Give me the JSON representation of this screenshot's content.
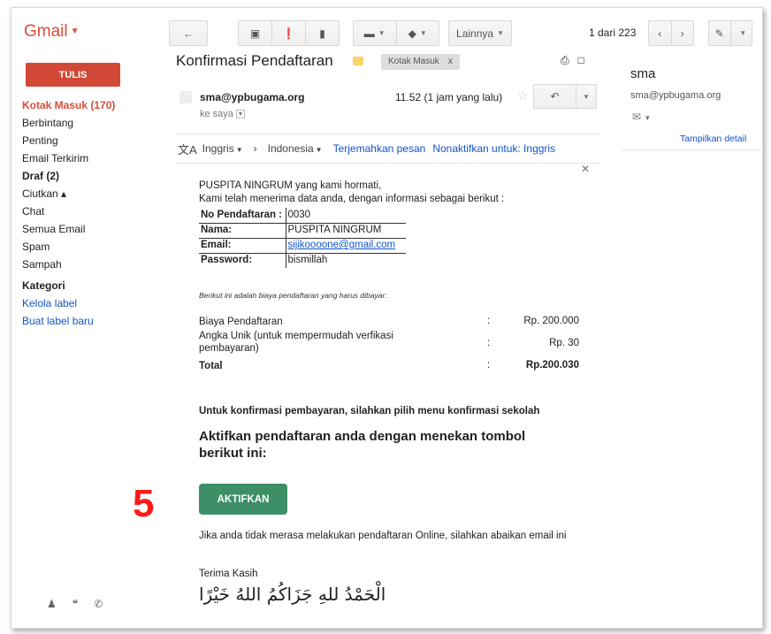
{
  "app": {
    "logo": "Gmail"
  },
  "toolbar": {
    "more_label": "Lainnya",
    "pager": "1 dari 223"
  },
  "sidebar": {
    "compose": "TULIS",
    "items": [
      {
        "label": "Kotak Masuk (170)"
      },
      {
        "label": "Berbintang"
      },
      {
        "label": "Penting"
      },
      {
        "label": "Email Terkirim"
      },
      {
        "label": "Draf (2)"
      },
      {
        "label": "Ciutkan ▴"
      },
      {
        "label": "Chat"
      },
      {
        "label": "Semua Email"
      },
      {
        "label": "Spam"
      },
      {
        "label": "Sampah"
      },
      {
        "label": "Kategori"
      },
      {
        "label": "Kelola label"
      },
      {
        "label": "Buat label baru"
      }
    ]
  },
  "message": {
    "subject": "Konfirmasi Pendaftaran",
    "label": "Kotak Masuk",
    "label_close": "x",
    "sender": "sma@ypbugama.org",
    "to": "ke saya",
    "time": "11.52 (1 jam yang lalu)",
    "translate": {
      "from": "Inggris",
      "to": "Indonesia",
      "translate_link": "Terjemahkan pesan",
      "disable_link": "Nonaktifkan untuk: Inggris"
    },
    "greeting": "PUSPITA NINGRUM yang kami hormati,",
    "intro": "Kami telah menerima data anda, dengan informasi sebagai berikut :",
    "registration": [
      {
        "key": "No Pendaftaran :",
        "value": "0030"
      },
      {
        "key": "Nama:",
        "value": "PUSPITA NINGRUM"
      },
      {
        "key": "Email:",
        "value": "sijikoooone@gmail.com"
      },
      {
        "key": "Password:",
        "value": "bismillah"
      }
    ],
    "fee_intro": "Berikut ini adalah biaya pendaftaran yang harus dibayar:",
    "fees": [
      {
        "name": "Biaya Pendaftaran",
        "colon": ":",
        "amount": "Rp. 200.000"
      },
      {
        "name": "Angka Unik (untuk mempermudah verfikasi pembayaran)",
        "colon": ":",
        "amount": "Rp. 30"
      },
      {
        "name": "Total",
        "colon": ":",
        "amount": "Rp.200.030"
      }
    ],
    "confirm_text": "Untuk konfirmasi pembayaran, silahkan pilih menu konfirmasi sekolah",
    "activate_heading": "Aktifkan pendaftaran anda dengan menekan tombol berikut ini:",
    "activate_button": "AKTIFKAN",
    "ignore_text": "Jika anda tidak merasa melakukan pendaftaran Online, silahkan abaikan email ini",
    "thanks": "Terima Kasih",
    "arabic": "الْحَمْدُ للهِ جَزَاكُمُ اللهُ خَيْرًا"
  },
  "annotation": {
    "step": "5"
  },
  "contact": {
    "name": "sma",
    "email": "sma@ypbugama.org",
    "detail_link": "Tampilkan detail"
  }
}
